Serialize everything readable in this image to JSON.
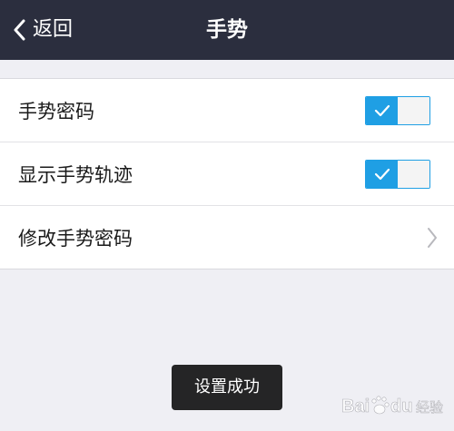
{
  "nav": {
    "back_label": "返回",
    "title": "手势"
  },
  "settings": {
    "gesture_password": {
      "label": "手势密码",
      "enabled": true
    },
    "show_gesture_trail": {
      "label": "显示手势轨迹",
      "enabled": true
    },
    "change_gesture_password": {
      "label": "修改手势密码"
    }
  },
  "toast": {
    "message": "设置成功"
  },
  "watermark": {
    "text": "Baidu 经验"
  },
  "colors": {
    "nav_background": "#2b2e3e",
    "toggle_accent": "#1f9fe4",
    "page_background": "#efeff4"
  }
}
